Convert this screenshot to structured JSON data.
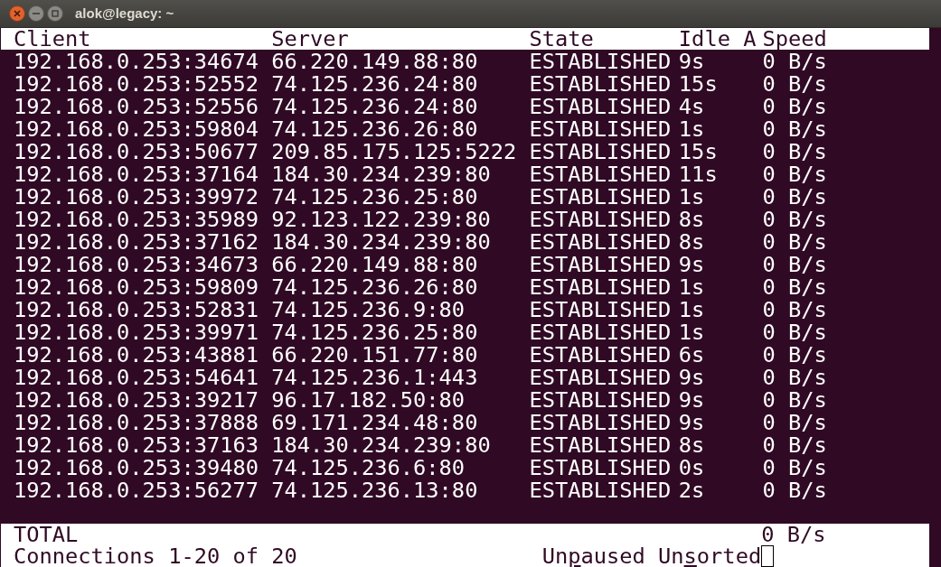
{
  "window": {
    "title": "alok@legacy: ~"
  },
  "table": {
    "columns": [
      "Client",
      "Server",
      "State",
      "Idle A",
      "Speed"
    ],
    "rows": [
      [
        "192.168.0.253:34674",
        "66.220.149.88:80",
        "ESTABLISHED",
        "9s",
        "0 B/s"
      ],
      [
        "192.168.0.253:52552",
        "74.125.236.24:80",
        "ESTABLISHED",
        "15s",
        "0 B/s"
      ],
      [
        "192.168.0.253:52556",
        "74.125.236.24:80",
        "ESTABLISHED",
        "4s",
        "0 B/s"
      ],
      [
        "192.168.0.253:59804",
        "74.125.236.26:80",
        "ESTABLISHED",
        "1s",
        "0 B/s"
      ],
      [
        "192.168.0.253:50677",
        "209.85.175.125:5222",
        "ESTABLISHED",
        "15s",
        "0 B/s"
      ],
      [
        "192.168.0.253:37164",
        "184.30.234.239:80",
        "ESTABLISHED",
        "11s",
        "0 B/s"
      ],
      [
        "192.168.0.253:39972",
        "74.125.236.25:80",
        "ESTABLISHED",
        "1s",
        "0 B/s"
      ],
      [
        "192.168.0.253:35989",
        "92.123.122.239:80",
        "ESTABLISHED",
        "8s",
        "0 B/s"
      ],
      [
        "192.168.0.253:37162",
        "184.30.234.239:80",
        "ESTABLISHED",
        "8s",
        "0 B/s"
      ],
      [
        "192.168.0.253:34673",
        "66.220.149.88:80",
        "ESTABLISHED",
        "9s",
        "0 B/s"
      ],
      [
        "192.168.0.253:59809",
        "74.125.236.26:80",
        "ESTABLISHED",
        "1s",
        "0 B/s"
      ],
      [
        "192.168.0.253:52831",
        "74.125.236.9:80",
        "ESTABLISHED",
        "1s",
        "0 B/s"
      ],
      [
        "192.168.0.253:39971",
        "74.125.236.25:80",
        "ESTABLISHED",
        "1s",
        "0 B/s"
      ],
      [
        "192.168.0.253:43881",
        "66.220.151.77:80",
        "ESTABLISHED",
        "6s",
        "0 B/s"
      ],
      [
        "192.168.0.253:54641",
        "74.125.236.1:443",
        "ESTABLISHED",
        "9s",
        "0 B/s"
      ],
      [
        "192.168.0.253:39217",
        "96.17.182.50:80",
        "ESTABLISHED",
        "9s",
        "0 B/s"
      ],
      [
        "192.168.0.253:37888",
        "69.171.234.48:80",
        "ESTABLISHED",
        "9s",
        "0 B/s"
      ],
      [
        "192.168.0.253:37163",
        "184.30.234.239:80",
        "ESTABLISHED",
        "8s",
        "0 B/s"
      ],
      [
        "192.168.0.253:39480",
        "74.125.236.6:80",
        "ESTABLISHED",
        "0s",
        "0 B/s"
      ],
      [
        "192.168.0.253:56277",
        "74.125.236.13:80",
        "ESTABLISHED",
        "2s",
        "0 B/s"
      ]
    ]
  },
  "total": {
    "label": "TOTAL",
    "speed": "0 B/s"
  },
  "status_bar": {
    "connections": "Connections 1-20 of 20",
    "toggles": [
      {
        "before": "Un",
        "key": "p",
        "after": "aused"
      },
      {
        "before": "Un",
        "key": "s",
        "after": "orted"
      }
    ],
    "cursor": true
  }
}
